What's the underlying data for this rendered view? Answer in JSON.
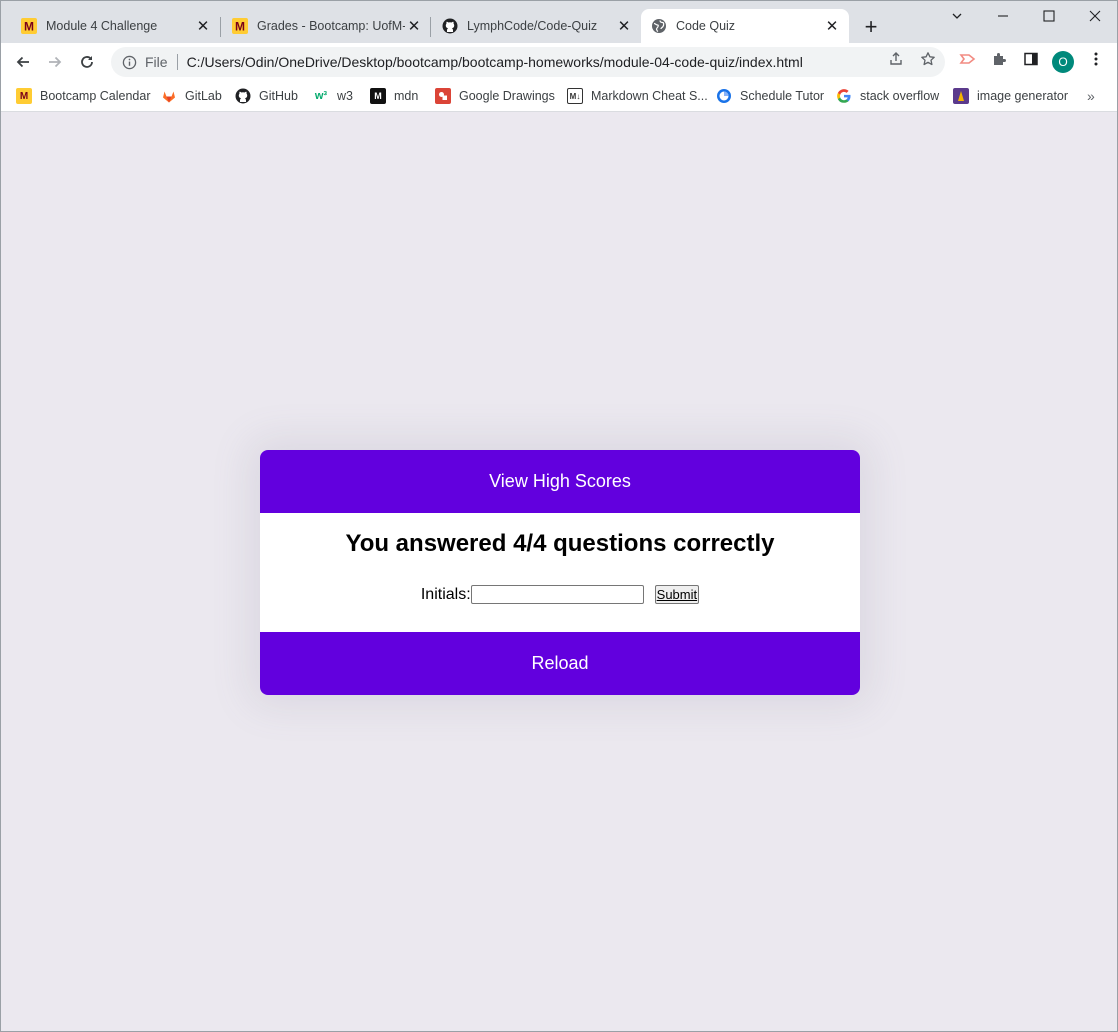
{
  "browser": {
    "tabs": [
      {
        "title": "Module 4 Challenge",
        "icon": "umn-icon",
        "active": false
      },
      {
        "title": "Grades - Bootcamp: UofM-VIRT",
        "icon": "umn-icon",
        "active": false
      },
      {
        "title": "LymphCode/Code-Quiz",
        "icon": "github-icon",
        "active": false
      },
      {
        "title": "Code Quiz",
        "icon": "globe-icon",
        "active": true
      }
    ],
    "new_tab_label": "+",
    "address": {
      "scheme_label": "File",
      "url": "C:/Users/Odin/OneDrive/Desktop/bootcamp/bootcamp-homeworks/module-04-code-quiz/index.html"
    },
    "profile_initial": "O",
    "bookmarks": [
      {
        "label": "Bootcamp Calendar",
        "icon": "umn-icon"
      },
      {
        "label": "GitLab",
        "icon": "gitlab-icon"
      },
      {
        "label": "GitHub",
        "icon": "github-icon"
      },
      {
        "label": "w3",
        "icon": "w3-icon"
      },
      {
        "label": "mdn",
        "icon": "mdn-icon"
      },
      {
        "label": "Google Drawings",
        "icon": "drawings-icon"
      },
      {
        "label": "Markdown Cheat S...",
        "icon": "markdown-icon"
      },
      {
        "label": "Schedule Tutor",
        "icon": "schedule-icon"
      },
      {
        "label": "stack overflow",
        "icon": "google-icon"
      },
      {
        "label": "image generator",
        "icon": "image-gen-icon"
      }
    ],
    "bookmarks_more": "»"
  },
  "quiz": {
    "view_high_scores": "View High Scores",
    "result": "You answered 4/4 questions correctly",
    "initials_label": "Initials:",
    "initials_value": "",
    "submit_label": "Submit",
    "reload_label": "Reload"
  },
  "colors": {
    "accent": "#6200de",
    "page_bg": "#ebe8ef"
  }
}
